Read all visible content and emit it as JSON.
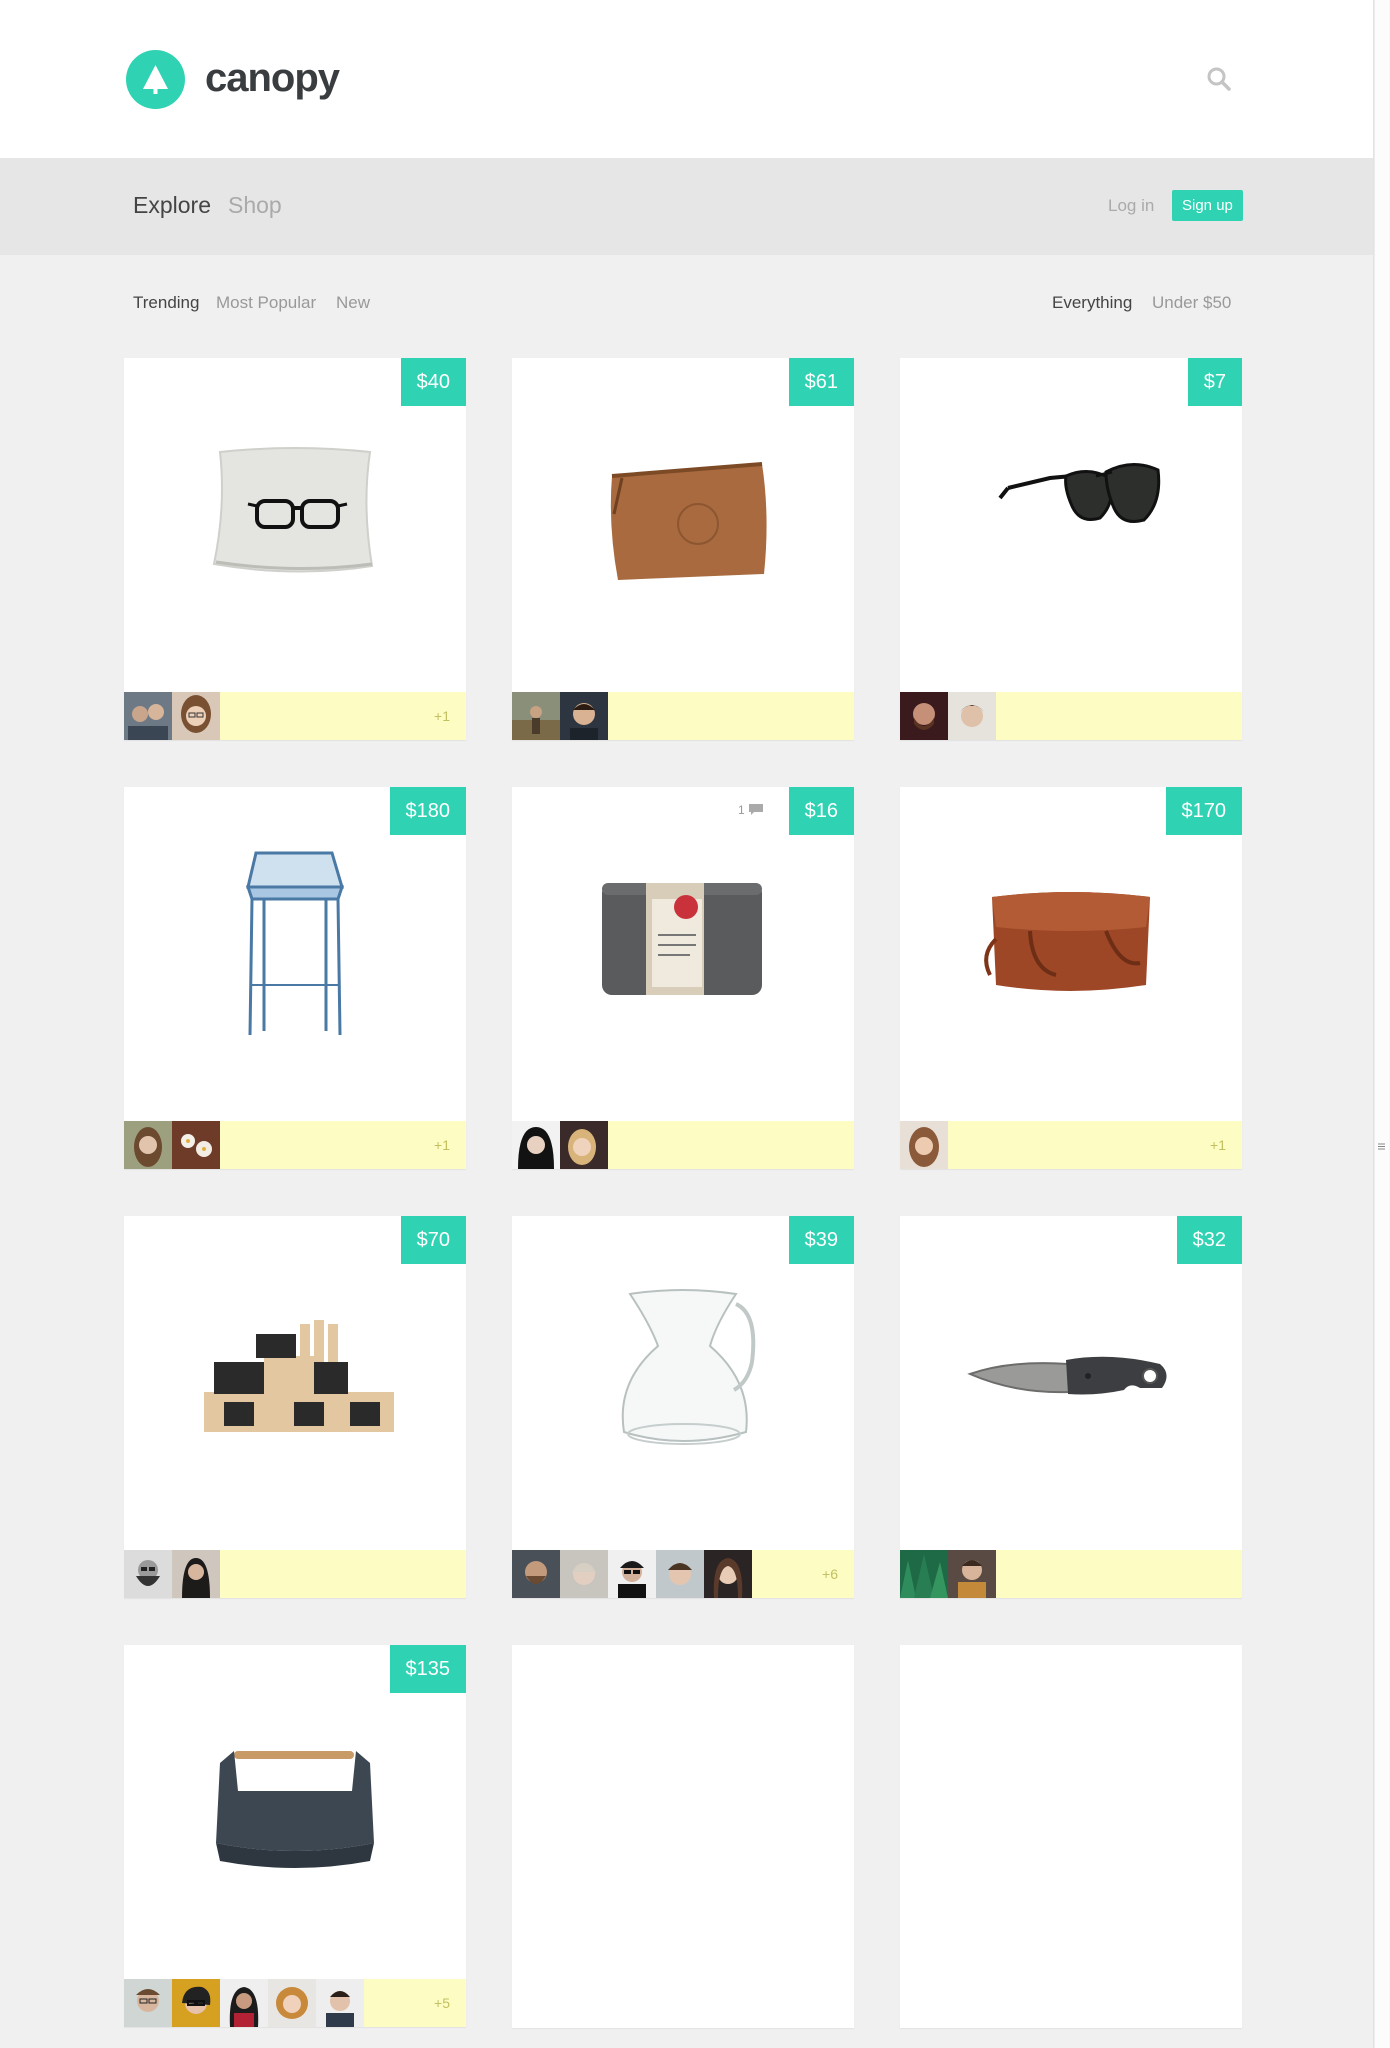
{
  "brand": {
    "name": "canopy",
    "color": "#2fd3b3"
  },
  "nav": {
    "explore": "Explore",
    "shop": "Shop",
    "login": "Log in",
    "signup": "Sign up"
  },
  "filters": {
    "sort": [
      {
        "label": "Trending",
        "active": true
      },
      {
        "label": "Most Popular",
        "active": false
      },
      {
        "label": "New",
        "active": false
      }
    ],
    "price": [
      {
        "label": "Everything",
        "active": true
      },
      {
        "label": "Under $50",
        "active": false
      }
    ]
  },
  "products": [
    {
      "price": "$40",
      "item": "glasses-pillow",
      "avatars": 2,
      "more": "+1"
    },
    {
      "price": "$61",
      "item": "leather-pouch",
      "avatars": 2,
      "more": ""
    },
    {
      "price": "$7",
      "item": "aviator-sunglasses",
      "avatars": 2,
      "more": ""
    },
    {
      "price": "$180",
      "item": "wire-bar-stool",
      "avatars": 2,
      "more": "+1"
    },
    {
      "price": "$16",
      "item": "yoga-block",
      "avatars": 2,
      "more": "",
      "comments": "1"
    },
    {
      "price": "$170",
      "item": "leather-tote-bag",
      "avatars": 1,
      "more": "+1"
    },
    {
      "price": "$70",
      "item": "alphabet-blocks",
      "avatars": 2,
      "more": ""
    },
    {
      "price": "$39",
      "item": "glass-carafe",
      "avatars": 5,
      "more": "+6"
    },
    {
      "price": "$32",
      "item": "folding-knife",
      "avatars": 2,
      "more": ""
    },
    {
      "price": "$135",
      "item": "tool-box",
      "avatars": 5,
      "more": "+5"
    }
  ]
}
